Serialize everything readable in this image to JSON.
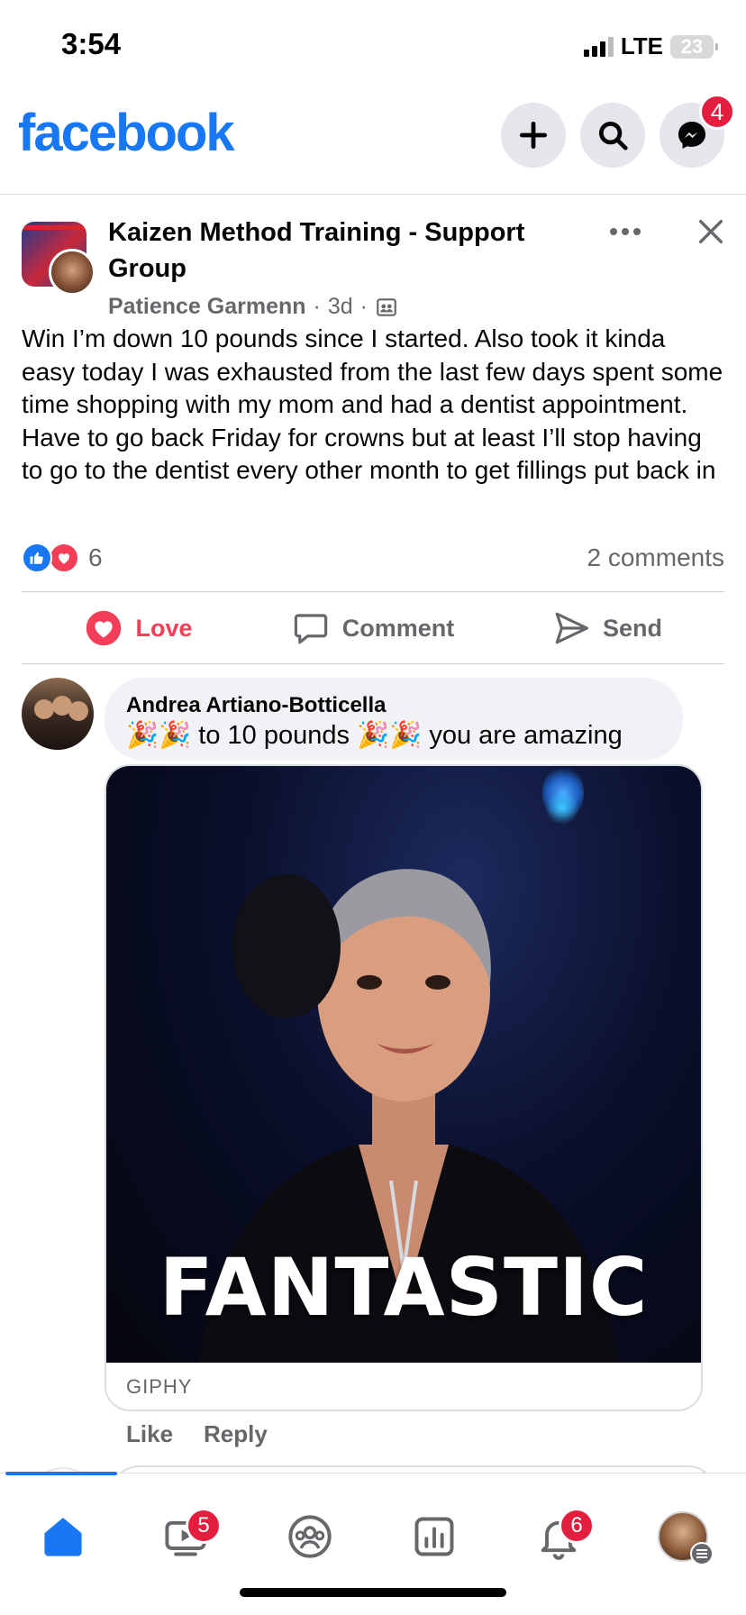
{
  "status_bar": {
    "time": "3:54",
    "network": "LTE",
    "battery": "23"
  },
  "header": {
    "logo": "facebook",
    "messenger_badge": "4",
    "brand_color": "#1877f2"
  },
  "post": {
    "group_name": "Kaizen Method Training - Support Group",
    "author": "Patience Garmenn",
    "time_ago": "3d",
    "separator": "·",
    "body": "Win I’m down 10 pounds since I started. Also took it kinda easy today I was exhausted from the last few days spent some time shopping with my mom and had a dentist appointment. Have to go back Friday for crowns but at least I’ll stop having to go to the dentist every other month to get fillings put back in",
    "reaction_count": "6",
    "comments_count": "2 comments",
    "actions": {
      "love": "Love",
      "comment": "Comment",
      "send": "Send"
    }
  },
  "comment": {
    "author": "Andrea Artiano-Botticella",
    "emoji": "🎉🎉",
    "text_part1": " to 10 pounds ",
    "text_part2": " you are amazing",
    "gif_caption": "FANTASTIC",
    "gif_source": "GIPHY",
    "like_label": "Like",
    "reply_label": "Reply"
  },
  "bottom_nav": {
    "watch_badge": "5",
    "notifications_badge": "6",
    "items": [
      "home-icon",
      "watch-icon",
      "groups-icon",
      "feeds-icon",
      "notifications-icon",
      "profile-menu"
    ]
  }
}
